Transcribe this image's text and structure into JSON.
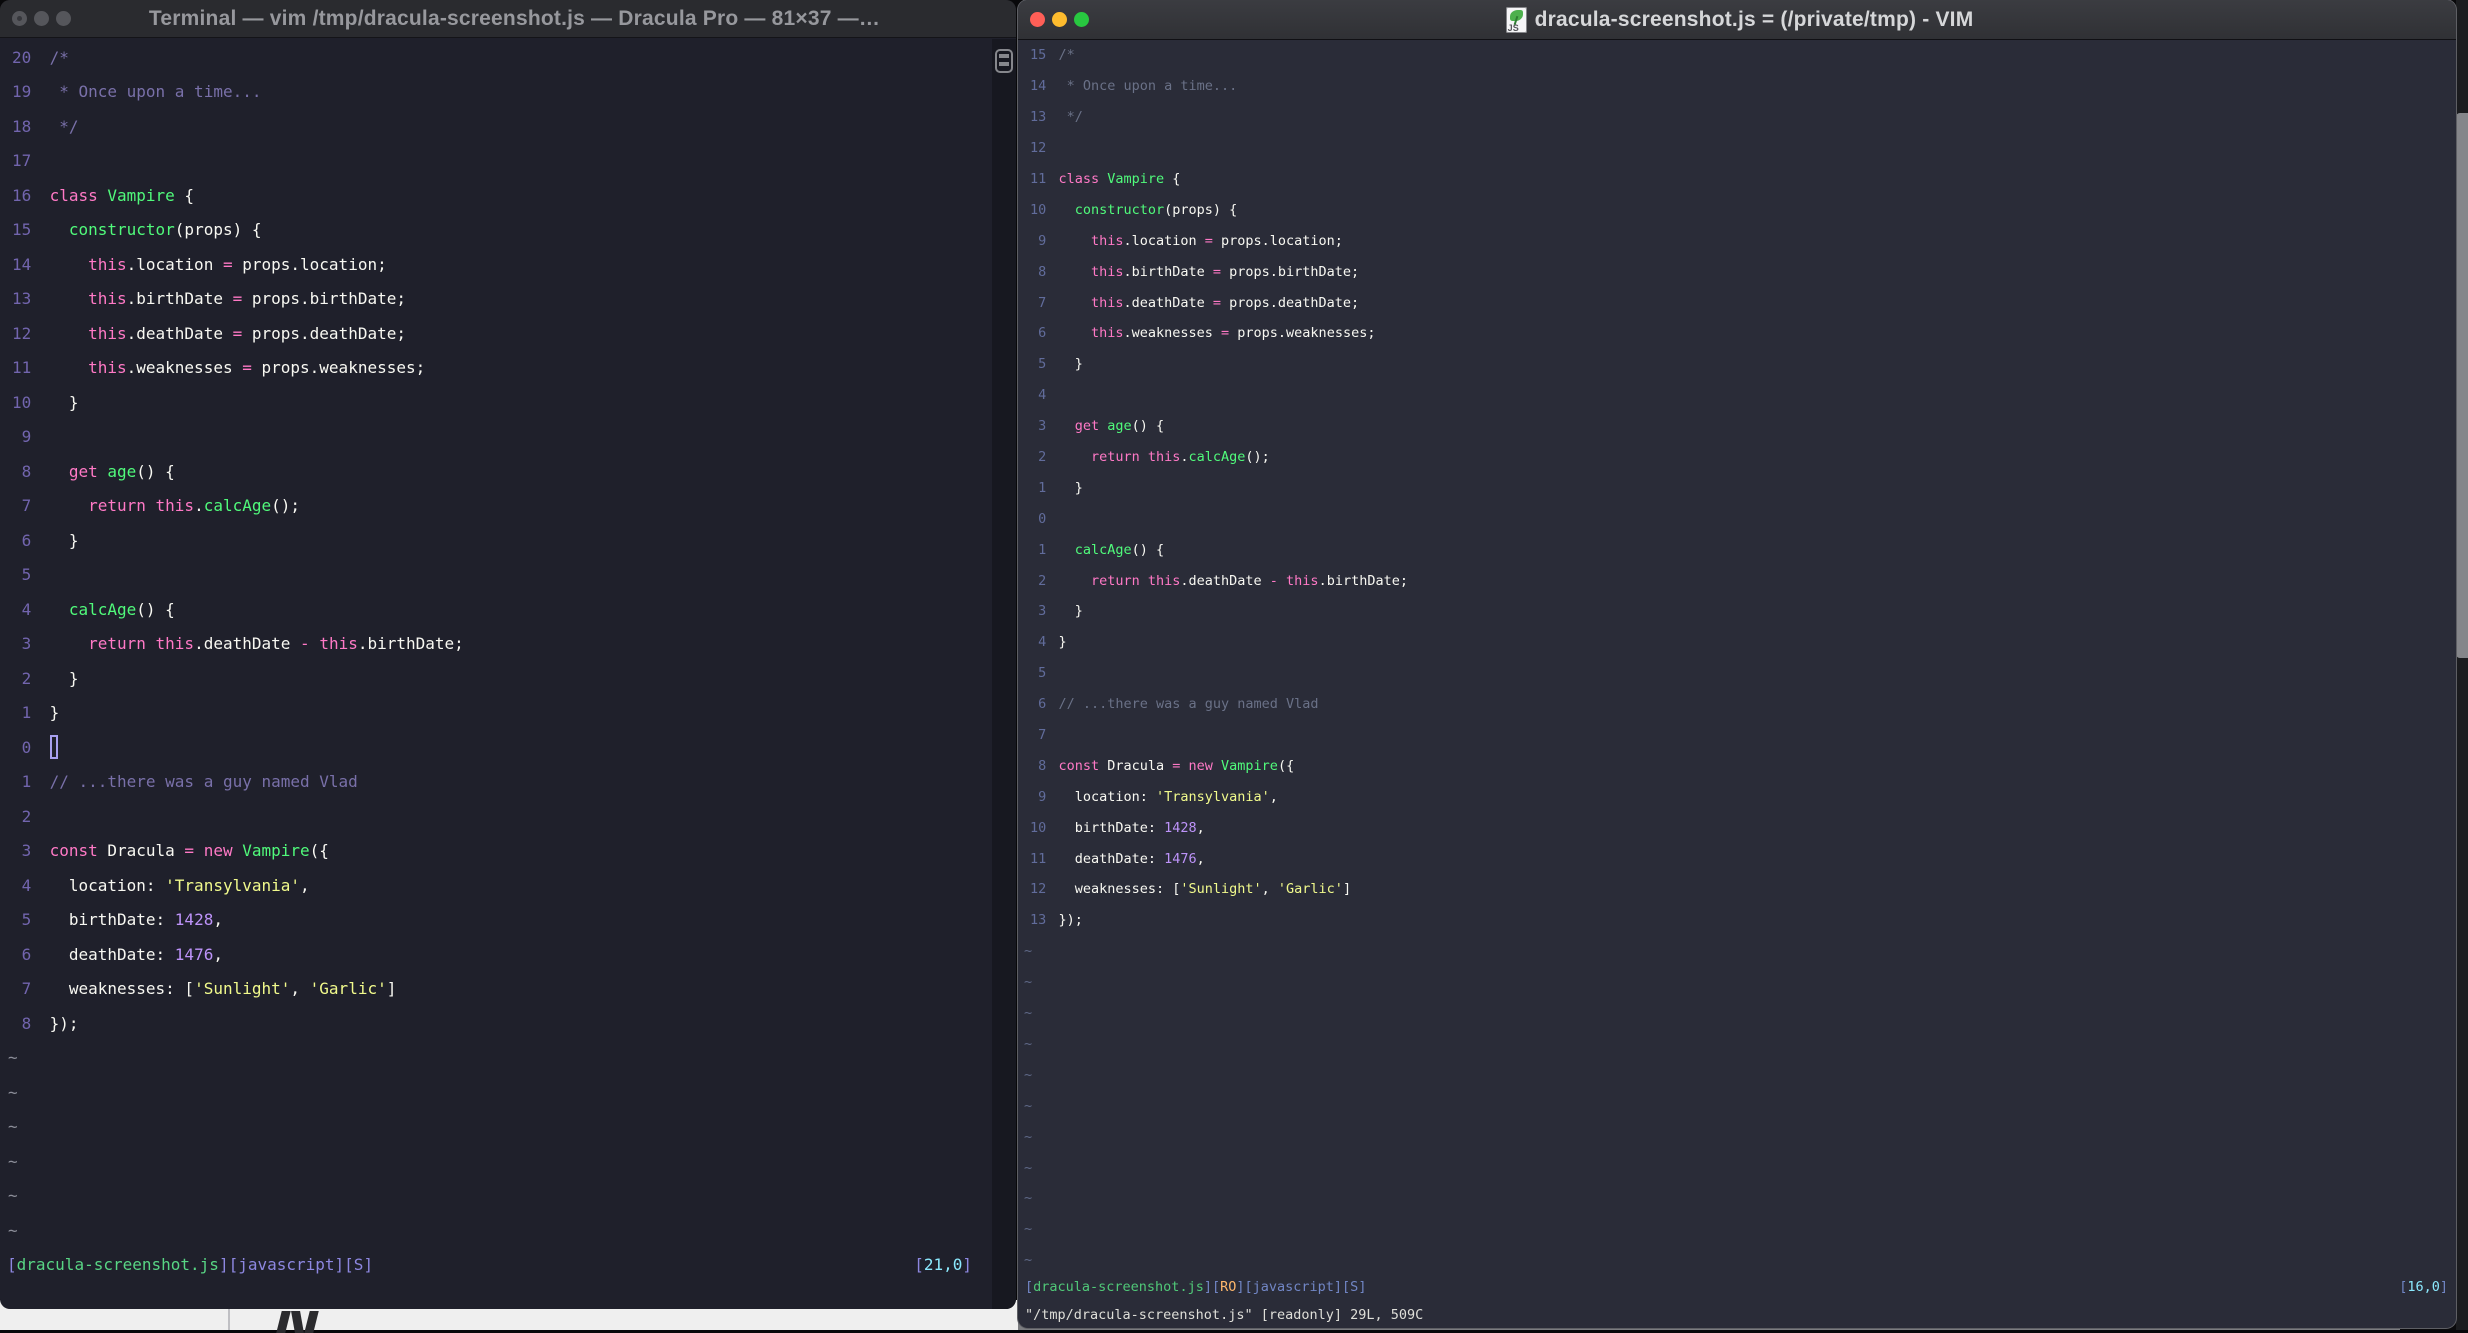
{
  "colors": {
    "shared": {
      "pink": "#ff79c6",
      "green": "#50fa7b",
      "yellow": "#f1fa8c",
      "number_purple": "#bd93f9",
      "foreground": "#f8f8f2",
      "left_bg": "#1f202b",
      "right_bg": "#2a2c38",
      "traffic_red": "#ff5f57",
      "traffic_yellow": "#febc2e",
      "traffic_green": "#28c840",
      "coord_cyan": "#8be9fd",
      "readonly_orange": "#ffb86c"
    }
  },
  "code_lines": [
    [
      [
        "c",
        "/*"
      ]
    ],
    [
      [
        "c",
        " * Once upon a time..."
      ]
    ],
    [
      [
        "c",
        " */"
      ]
    ],
    [],
    [
      [
        "p",
        "class "
      ],
      [
        "g",
        "Vampire"
      ],
      [
        "f",
        " {"
      ]
    ],
    [
      [
        "f",
        "  "
      ],
      [
        "g",
        "constructor"
      ],
      [
        "f",
        "(props) {"
      ]
    ],
    [
      [
        "f",
        "    "
      ],
      [
        "p",
        "this"
      ],
      [
        "f",
        ".location "
      ],
      [
        "p",
        "="
      ],
      [
        "f",
        " props.location;"
      ]
    ],
    [
      [
        "f",
        "    "
      ],
      [
        "p",
        "this"
      ],
      [
        "f",
        ".birthDate "
      ],
      [
        "p",
        "="
      ],
      [
        "f",
        " props.birthDate;"
      ]
    ],
    [
      [
        "f",
        "    "
      ],
      [
        "p",
        "this"
      ],
      [
        "f",
        ".deathDate "
      ],
      [
        "p",
        "="
      ],
      [
        "f",
        " props.deathDate;"
      ]
    ],
    [
      [
        "f",
        "    "
      ],
      [
        "p",
        "this"
      ],
      [
        "f",
        ".weaknesses "
      ],
      [
        "p",
        "="
      ],
      [
        "f",
        " props.weaknesses;"
      ]
    ],
    [
      [
        "f",
        "  }"
      ]
    ],
    [],
    [
      [
        "f",
        "  "
      ],
      [
        "p",
        "get "
      ],
      [
        "g",
        "age"
      ],
      [
        "f",
        "() {"
      ]
    ],
    [
      [
        "f",
        "    "
      ],
      [
        "p",
        "return this"
      ],
      [
        "f",
        "."
      ],
      [
        "g",
        "calcAge"
      ],
      [
        "f",
        "();"
      ]
    ],
    [
      [
        "f",
        "  }"
      ]
    ],
    [],
    [
      [
        "f",
        "  "
      ],
      [
        "g",
        "calcAge"
      ],
      [
        "f",
        "() {"
      ]
    ],
    [
      [
        "f",
        "    "
      ],
      [
        "p",
        "return this"
      ],
      [
        "f",
        ".deathDate "
      ],
      [
        "p",
        "-"
      ],
      [
        "f",
        " "
      ],
      [
        "p",
        "this"
      ],
      [
        "f",
        ".birthDate;"
      ]
    ],
    [
      [
        "f",
        "  }"
      ]
    ],
    [
      [
        "f",
        "}"
      ]
    ],
    [],
    [
      [
        "c",
        "// ...there was a guy named Vlad"
      ]
    ],
    [],
    [
      [
        "p",
        "const "
      ],
      [
        "f",
        "Dracula "
      ],
      [
        "p",
        "= new "
      ],
      [
        "g",
        "Vampire"
      ],
      [
        "f",
        "({"
      ]
    ],
    [
      [
        "f",
        "  location: "
      ],
      [
        "y",
        "'Transylvania'"
      ],
      [
        "f",
        ","
      ]
    ],
    [
      [
        "f",
        "  birthDate: "
      ],
      [
        "n",
        "1428"
      ],
      [
        "f",
        ","
      ]
    ],
    [
      [
        "f",
        "  deathDate: "
      ],
      [
        "n",
        "1476"
      ],
      [
        "f",
        ","
      ]
    ],
    [
      [
        "f",
        "  weaknesses: ["
      ],
      [
        "y",
        "'Sunlight'"
      ],
      [
        "f",
        ", "
      ],
      [
        "y",
        "'Garlic'"
      ],
      [
        "f",
        "]"
      ]
    ],
    [
      [
        "f",
        "});"
      ]
    ]
  ],
  "left_window": {
    "title": "Terminal — vim /tmp/dracula-screenshot.js — Dracula Pro — 81×37 —…",
    "numbers": [
      "20",
      "19",
      "18",
      "17",
      "16",
      "15",
      "14",
      "13",
      "12",
      "11",
      "10",
      "9",
      "8",
      "7",
      "6",
      "5",
      "4",
      "3",
      "2",
      "1",
      "0",
      "1",
      "2",
      "3",
      "4",
      "5",
      "6",
      "7",
      "8"
    ],
    "cursor_line_index": 20,
    "tilde": "~",
    "tilde_count": 6,
    "status_left": [
      [
        "b",
        "["
      ],
      [
        "file",
        "dracula-screenshot.js"
      ],
      [
        "b",
        "]["
      ],
      [
        "lang",
        "javascript"
      ],
      [
        "b",
        "]["
      ],
      [
        "lang",
        "S"
      ],
      [
        "b",
        "]"
      ]
    ],
    "status_right": [
      [
        "b",
        "["
      ],
      [
        "coord",
        "21,0"
      ],
      [
        "b",
        "]"
      ]
    ]
  },
  "right_window": {
    "title": "dracula-screenshot.js = (/private/tmp) - VIM",
    "icon_label": "JS",
    "numbers": [
      "15",
      "14",
      "13",
      "12",
      "11",
      "10",
      "9",
      "8",
      "7",
      "6",
      "5",
      "4",
      "3",
      "2",
      "1",
      "0",
      "1",
      "2",
      "3",
      "4",
      "5",
      "6",
      "7",
      "8",
      "9",
      "10",
      "11",
      "12",
      "13"
    ],
    "cursor_line_index": null,
    "tilde": "~",
    "tilde_count": 11,
    "status_left": [
      [
        "b",
        "["
      ],
      [
        "file",
        "dracula-screenshot.js"
      ],
      [
        "b",
        "]["
      ],
      [
        "ro",
        "RO"
      ],
      [
        "b",
        "]["
      ],
      [
        "lang",
        "javascript"
      ],
      [
        "b",
        "]["
      ],
      [
        "lang",
        "S"
      ],
      [
        "b",
        "]"
      ]
    ],
    "status_right": [
      [
        "b",
        "["
      ],
      [
        "coord",
        "16,0"
      ],
      [
        "b",
        "]"
      ]
    ],
    "cmdline": "\"/tmp/dracula-screenshot.js\" [readonly] 29L, 509C"
  }
}
